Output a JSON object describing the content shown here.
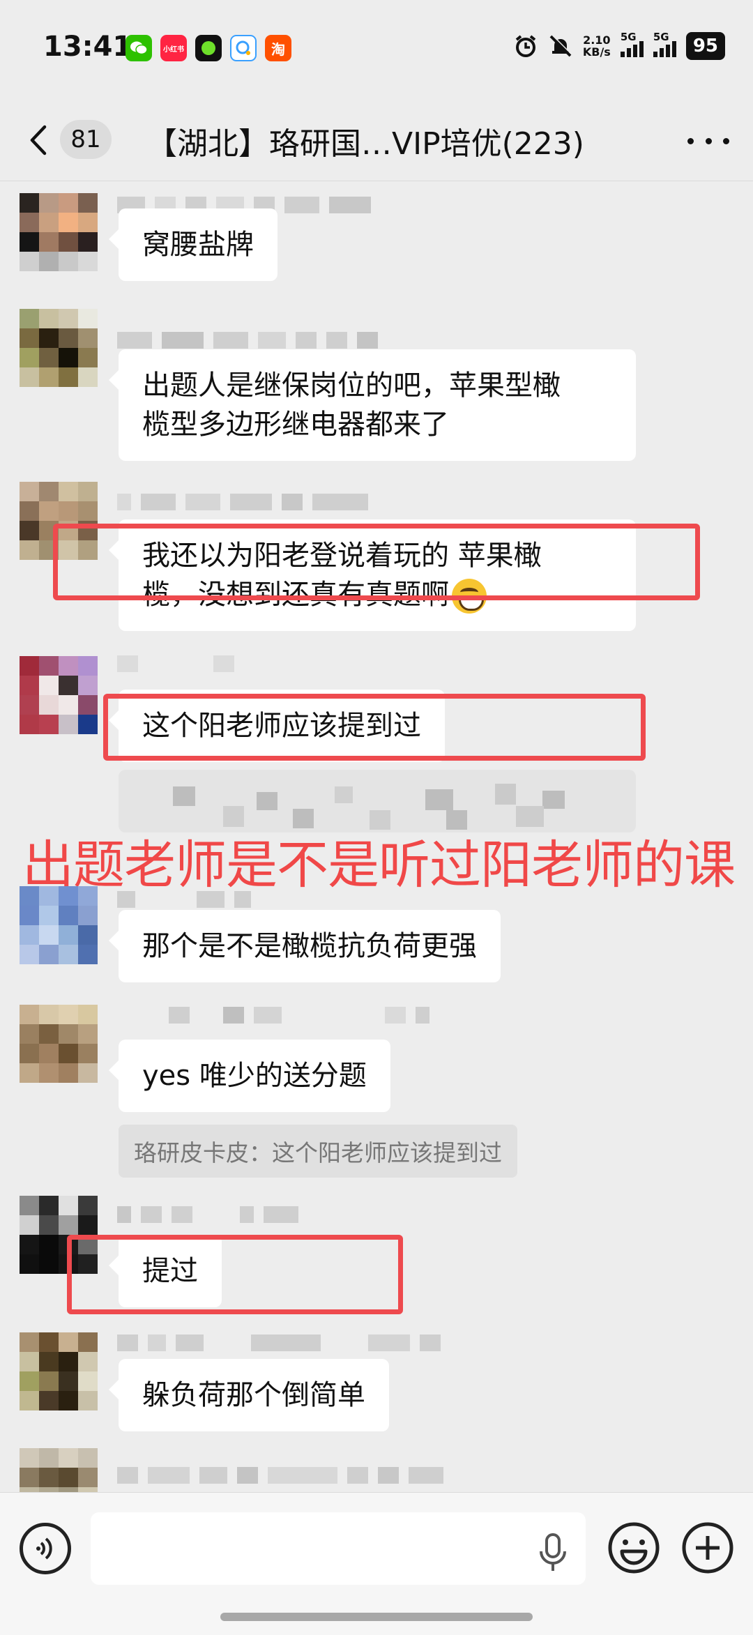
{
  "status_bar": {
    "time": "13:41",
    "apps": [
      {
        "name": "wechat-icon",
        "color": "#2dc100",
        "label": ""
      },
      {
        "name": "xiaohongshu-icon",
        "color": "#ff2442",
        "label": "小红书"
      },
      {
        "name": "game-icon",
        "color": "#111111",
        "label": ""
      },
      {
        "name": "map-icon",
        "color": "#3aa0ff",
        "label": ""
      },
      {
        "name": "taobao-icon",
        "color": "#ff5000",
        "label": "淘"
      }
    ],
    "net_speed_value": "2.10",
    "net_speed_unit": "KB/s",
    "signal_label_1": "5G",
    "signal_label_2": "5G",
    "battery": "95"
  },
  "nav": {
    "unread_count": "81",
    "title": "【湖北】珞研国…VIP培优(223)"
  },
  "messages": [
    {
      "text": "窝腰盐牌"
    },
    {
      "text": "出题人是继保岗位的吧，苹果型橄\n榄型多边形继电器都来了"
    },
    {
      "text": "我还以为阳老登说着玩的 苹果橄\n榄，没想到还真有真题啊"
    },
    {
      "text": "这个阳老师应该提到过"
    },
    {
      "text": "那个是不是橄榄抗负荷更强"
    },
    {
      "text": "yes 唯少的送分题"
    },
    {
      "text": "提过"
    },
    {
      "text": "躲负荷那个倒简单"
    }
  ],
  "quote_reply": "珞研皮卡皮：这个阳老师应该提到过",
  "annotation": "出题老师是不是听过阳老师的课",
  "input": {
    "placeholder": ""
  },
  "colors": {
    "highlight_red": "#ee4a4e",
    "annotation_red": "#f04848",
    "background": "#ededed"
  }
}
